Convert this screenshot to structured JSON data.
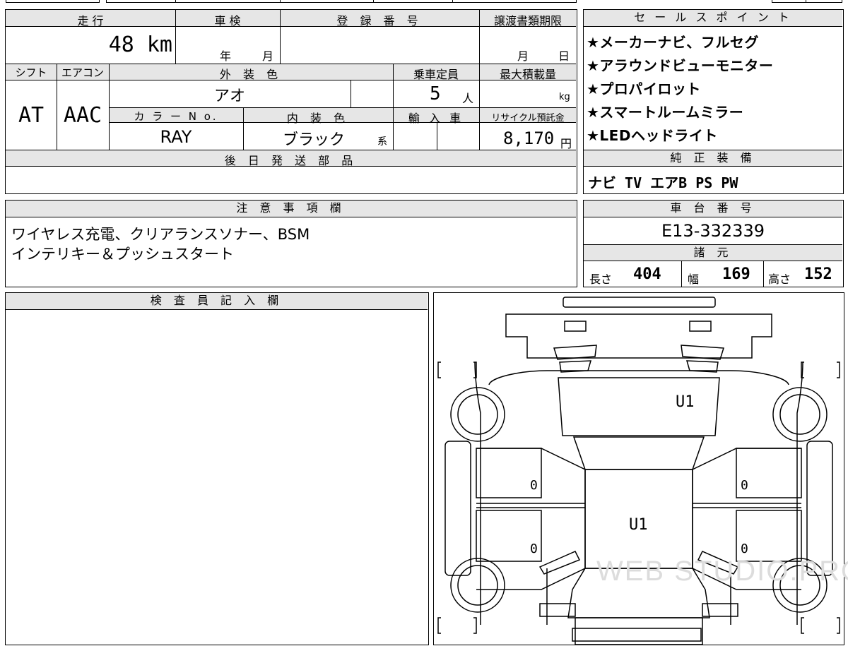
{
  "summary": {
    "headers": {
      "mileage": "走 行",
      "inspection": "車 検",
      "registration_number": "登 録 番 号",
      "transfer_deadline": "譲渡書類期限",
      "shift": "シフト",
      "aircon": "エアコン",
      "exterior_color": "外 装 色",
      "capacity": "乗車定員",
      "max_load": "最大積載量",
      "color_no": "カ ラ ー N o.",
      "interior_color": "内 装 色",
      "import": "輸 入 車",
      "recycle_fee": "リサイクル預託金",
      "parts_later": "後 日 発 送 部 品"
    },
    "mileage_value": "48 km",
    "inspection_year_unit": "年",
    "inspection_month_unit": "月",
    "deadline_month_unit": "月",
    "deadline_day_unit": "日",
    "shift_value": "AT",
    "aircon_value": "AAC",
    "exterior_color_value": "アオ",
    "capacity_value": "5",
    "capacity_unit": "人",
    "max_load_unit": "kg",
    "color_no_value": "RAY",
    "interior_color_value": "ブラック",
    "interior_color_suffix": "系",
    "recycle_value": "8,170",
    "recycle_unit": "円"
  },
  "sales_points": {
    "header": "セ ー ル ス ポ イ ン ト",
    "items": [
      "★メーカーナビ、フルセグ",
      "★アラウンドビューモニター",
      "★プロパイロット",
      "★スマートルームミラー",
      "★LEDヘッドライト"
    ]
  },
  "genuine_equipment": {
    "header": "純 正 装 備",
    "value": "ナビ TV エアB PS PW"
  },
  "notes": {
    "header": "注 意 事 項 欄",
    "lines": [
      "ワイヤレス充電、クリアランスソナー、BSM",
      "インテリキー＆プッシュスタート"
    ]
  },
  "chassis": {
    "header": "車 台 番 号",
    "value": "E13-332339"
  },
  "specs": {
    "header": "諸 元",
    "length_label": "長さ",
    "length_value": "404",
    "width_label": "幅",
    "width_value": "169",
    "height_label": "高さ",
    "height_value": "152"
  },
  "inspector": {
    "header": "検 査 員 記 入 欄"
  },
  "diagram": {
    "marks": {
      "hood": "U1",
      "roof": "U1",
      "left_front_door": "0",
      "left_rear_door": "0",
      "right_front_door": "0",
      "right_rear_door": "0"
    },
    "watermark": "WEB STUDIO.PRO"
  }
}
